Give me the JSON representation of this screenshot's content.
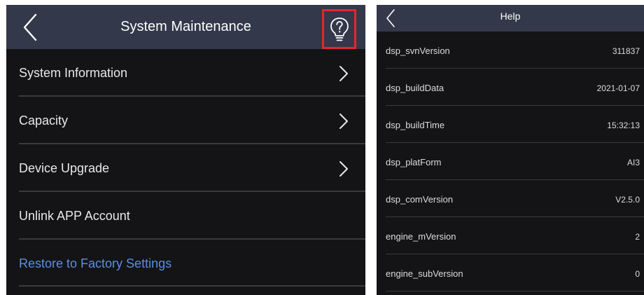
{
  "left_panel": {
    "title": "System Maintenance",
    "menu": [
      {
        "label": "System Information",
        "chevron": true,
        "style": "normal"
      },
      {
        "label": "Capacity",
        "chevron": true,
        "style": "normal"
      },
      {
        "label": "Device Upgrade",
        "chevron": true,
        "style": "normal"
      },
      {
        "label": "Unlink APP Account",
        "chevron": false,
        "style": "normal"
      },
      {
        "label": "Restore to Factory Settings",
        "chevron": false,
        "style": "link"
      }
    ],
    "highlight_color": "#e0282e",
    "link_color": "#5b8ee0",
    "help_icon": "lightbulb-question-icon"
  },
  "right_panel": {
    "title": "Help",
    "rows": [
      {
        "key": "dsp_svnVersion",
        "value": "311837"
      },
      {
        "key": "dsp_buildData",
        "value": "2021-01-07"
      },
      {
        "key": "dsp_buildTime",
        "value": "15:32:13"
      },
      {
        "key": "dsp_platForm",
        "value": "AI3"
      },
      {
        "key": "dsp_comVersion",
        "value": "V2.5.0"
      },
      {
        "key": "engine_mVersion",
        "value": "2"
      },
      {
        "key": "engine_subVersion",
        "value": "0"
      }
    ]
  },
  "colors": {
    "header_bg": "#33384a",
    "panel_bg": "#141416",
    "divider": "#3a3a3e"
  }
}
